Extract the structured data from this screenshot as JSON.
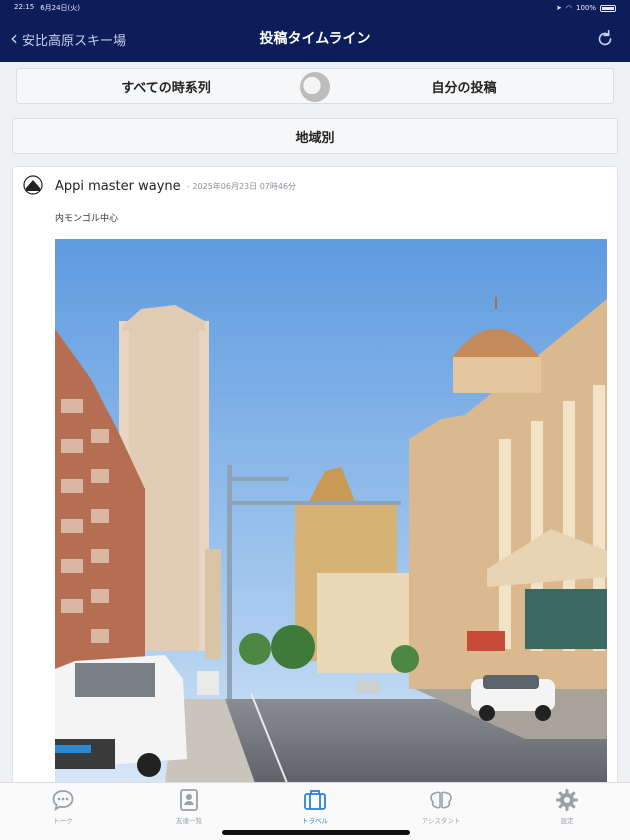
{
  "statusbar": {
    "time": "22:15",
    "date": "6月24日(火)",
    "battery": "100%"
  },
  "nav": {
    "back_label": "安比高原スキー場",
    "title": "投稿タイムライン",
    "refresh_icon": "refresh-icon"
  },
  "filters": {
    "all_label": "すべての時系列",
    "mine_label": "自分の投稿",
    "region_label": "地域別"
  },
  "post": {
    "user": "Appi master wayne",
    "time": "- 2025年06月23日 07時46分",
    "text": "内モンゴル中心",
    "photo_icon": "street-photo"
  },
  "tabs": [
    {
      "label": "トーク",
      "icon": "chat-bubble-icon",
      "active": false
    },
    {
      "label": "友達一覧",
      "icon": "contact-card-icon",
      "active": false
    },
    {
      "label": "トラベル",
      "icon": "suitcase-icon",
      "active": true
    },
    {
      "label": "アシスタント",
      "icon": "brain-icon",
      "active": false
    },
    {
      "label": "設定",
      "icon": "gear-icon",
      "active": false
    }
  ],
  "colors": {
    "header": "#0d1d5a",
    "active_tab": "#2b7de9",
    "inactive_tab": "#9aa0a8"
  }
}
